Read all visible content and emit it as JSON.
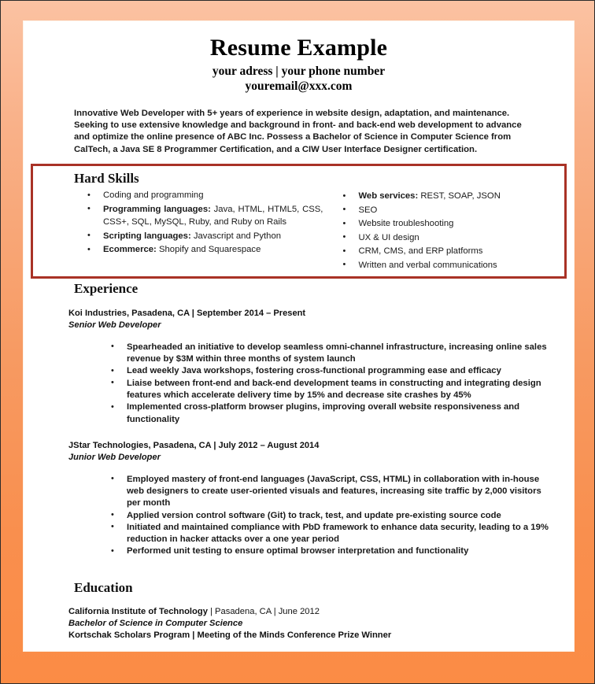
{
  "document": {
    "title": "Resume Example",
    "contact_line": "your adress | your phone number",
    "email": "youremail@xxx.com",
    "accent_border_color": "#f79a62",
    "highlight_box_color": "#a93226"
  },
  "summary": {
    "text": "Innovative Web Developer with 5+ years of experience in website design, adaptation, and maintenance. Seeking to use extensive knowledge and background in front- and back-end web development to advance and optimize the online presence of ABC Inc. Possess a Bachelor of Science in Computer Science from CalTech, a Java SE 8 Programmer Certification, and a CIW User Interface Designer certification."
  },
  "hard_skills": {
    "heading": "Hard Skills",
    "left_column": [
      {
        "label": "",
        "text": "Coding and programming"
      },
      {
        "label": "Programming languages:",
        "text": " Java, HTML, HTML5, CSS, CSS+, SQL, MySQL, Ruby, and Ruby on Rails"
      },
      {
        "label": "Scripting languages:",
        "text": " Javascript and Python"
      },
      {
        "label": "Ecommerce:",
        "text": " Shopify and Squarespace"
      }
    ],
    "right_column": [
      {
        "label": "Web services:",
        "text": " REST, SOAP, JSON"
      },
      {
        "label": "",
        "text": "SEO"
      },
      {
        "label": "",
        "text": "Website troubleshooting"
      },
      {
        "label": "",
        "text": "UX & UI design"
      },
      {
        "label": "",
        "text": "CRM, CMS, and ERP platforms"
      },
      {
        "label": "",
        "text": "Written and verbal communications"
      }
    ]
  },
  "experience": {
    "heading": "Experience",
    "jobs": [
      {
        "header": "Koi Industries, Pasadena, CA | September 2014 – Present",
        "role": "Senior Web Developer",
        "bullets": [
          "Spearheaded an initiative to develop seamless omni-channel infrastructure, increasing online sales revenue by $3M within three months of system launch",
          "Lead weekly Java workshops, fostering cross-functional programming ease and efficacy",
          "Liaise between front-end and back-end development teams in constructing and integrating design features which accelerate delivery time by 15% and decrease site crashes by 45%",
          "Implemented cross-platform browser plugins, improving overall website responsiveness and functionality"
        ]
      },
      {
        "header": "JStar Technologies, Pasadena, CA | July 2012 – August 2014",
        "role": "Junior Web Developer",
        "bullets": [
          "Employed mastery of front-end languages (JavaScript, CSS, HTML) in collaboration with in-house web designers to create user-oriented visuals and features, increasing site traffic by 2,000 visitors per month",
          "Applied version control software (Git) to track, test, and update pre-existing source code",
          "Initiated and maintained compliance with PbD framework to enhance data security, leading to a 19% reduction in hacker attacks over a one year period",
          "Performed unit testing to ensure optimal browser interpretation and functionality"
        ]
      }
    ]
  },
  "education": {
    "heading": "Education",
    "school": "California Institute of Technology",
    "school_meta": " | Pasadena, CA | June 2012",
    "degree": "Bachelor of Science in Computer Science",
    "extra": "Kortschak Scholars Program | Meeting of the Minds Conference Prize Winner"
  }
}
